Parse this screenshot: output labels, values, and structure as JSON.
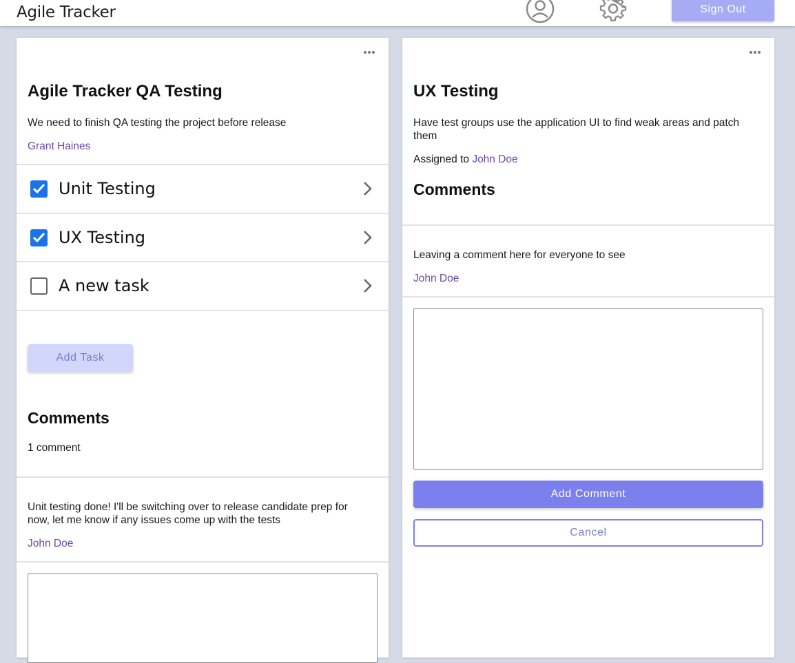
{
  "header": {
    "app_title": "Agile Tracker",
    "sign_out_label": "Sign Out",
    "icons": [
      "profile-icon",
      "gear-icon"
    ]
  },
  "left_panel": {
    "title": "Agile Tracker QA Testing",
    "description": "We need to finish QA testing the project before release",
    "author": "Grant Haines",
    "tasks": [
      {
        "label": "Unit Testing",
        "checked": true
      },
      {
        "label": "UX Testing",
        "checked": true
      },
      {
        "label": "A new task",
        "checked": false
      }
    ],
    "add_task_label": "Add Task",
    "comments_heading": "Comments",
    "comment_count": "1 comment",
    "comments": [
      {
        "text": "Unit testing done! I'll be switching over to release candidate prep for now, let me know if any issues come up with the tests",
        "author": "John Doe"
      }
    ],
    "comment_input": ""
  },
  "right_panel": {
    "title": "UX Testing",
    "description": "Have test groups use the application UI to find weak areas and patch them",
    "assigned_prefix": "Assigned to",
    "assignee": "John Doe",
    "comments_heading": "Comments",
    "comments": [
      {
        "text": "Leaving a comment here for everyone to see",
        "author": "John Doe"
      }
    ],
    "comment_input": "",
    "add_comment_label": "Add Comment",
    "cancel_label": "Cancel"
  },
  "colors": {
    "accent": "#7b80ec",
    "accent_light": "#a5acf3",
    "link": "#6b4aa8",
    "checkbox": "#1a73e8",
    "background": "#d6dae6"
  }
}
